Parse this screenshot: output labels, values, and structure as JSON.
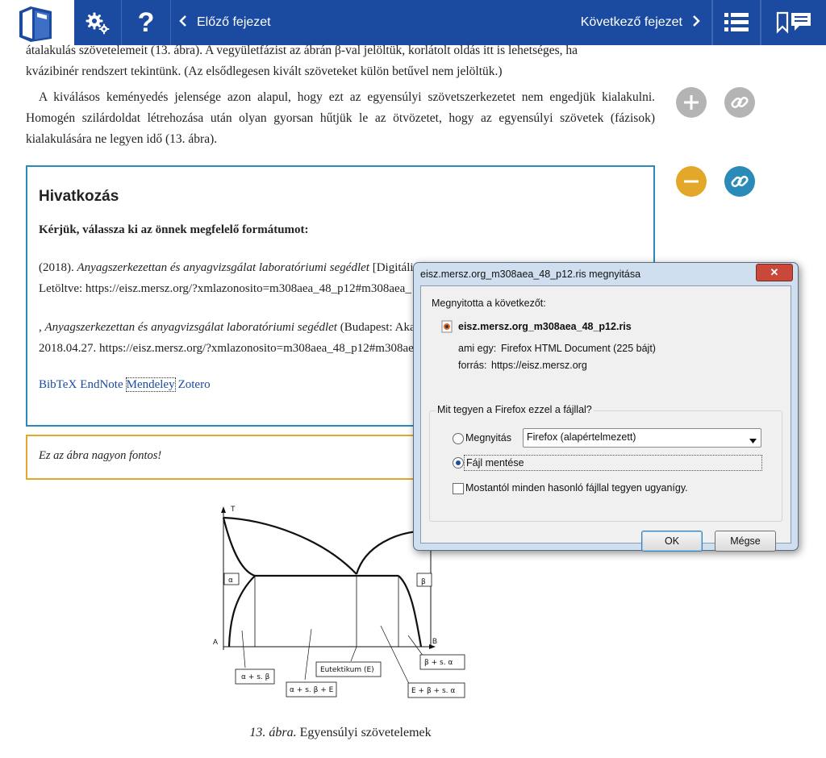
{
  "topbar": {
    "prev_label": "Előző fejezet",
    "next_label": "Következő fejezet",
    "help_glyph": "?"
  },
  "content": {
    "p1_line1": "átalakulás szövetelemeit (13. ábra). A vegyületfázist az ábrán β-val jelöltük, korlátolt oldás itt is lehetséges, ha",
    "p1_line2": "kvázibinér rendszert tekintünk. (Az elsődlegesen kivált szöveteket külön betűvel nem jelöltük.)",
    "p2": "A kiválásos keményedés jelensége azon alapul, hogy ezt az egyensúlyi szövetszerkezetet nem engedjük kialakulni. Homogén szilárdoldat létrehozása után olyan gyorsan hűtjük le az ötvözetet, hogy az egyensúlyi szövetek (fázisok) kialakulására ne legyen idő (13. ábra)."
  },
  "reference": {
    "title": "Hivatkozás",
    "subtitle": "Kérjük, válassza ki az önnek megfelelő formátumot:",
    "cite1_prefix": "(2018). ",
    "cite1_title": "Anyagszerkezettan és anyagvizsgálat laboratóriumi segédlet",
    "cite1_rest": " [Digitáli",
    "cite1_line2": "Letöltve: https://eisz.mersz.org/?xmlazonosito=m308aea_48_p12#m308aea_",
    "cite2_prefix": ", ",
    "cite2_title": "Anyagszerkezettan és anyagvizsgálat laboratóriumi segédlet",
    "cite2_rest": " (Budapest: Aka",
    "cite2_line2": "2018.04.27. https://eisz.mersz.org/?xmlazonosito=m308aea_48_p12#m308aea",
    "formats": [
      "BibTeX",
      "EndNote",
      "Mendeley",
      "Zotero"
    ]
  },
  "note": "Ez az ábra nagyon fontos!",
  "figure": {
    "axis_t": "T",
    "axis_a": "A",
    "axis_b": "B",
    "label_alpha": "α",
    "label_beta": "β",
    "label_a_sb": "α + s. β",
    "label_a_sb_e": "α + s. β + E",
    "label_eut": "Eutektikum (E)",
    "label_b_sa": "β + s. α",
    "label_e_b_sa": "E + β + s. α"
  },
  "caption_num": "13. ábra.",
  "caption_text": " Egyensúlyi szövetelemek",
  "dialog": {
    "title": "eisz.mersz.org_m308aea_48_p12.ris megnyitása",
    "close": "✕",
    "opened_label": "Megnyitotta a következőt:",
    "filename": "eisz.mersz.org_m308aea_48_p12.ris",
    "type_key": "ami egy:",
    "type_value": "Firefox HTML Document (225 bájt)",
    "source_key": "forrás:",
    "source_value": "https://eisz.mersz.org",
    "question": "Mit tegyen a Firefox ezzel a fájllal?",
    "open_with": "Megnyitás",
    "app_select": "Firefox (alapértelmezett)",
    "save_file": "Fájl mentése",
    "remember": "Mostantól minden hasonló fájllal tegyen ugyanígy.",
    "ok": "OK",
    "cancel": "Mégse",
    "selected_option": "save_file",
    "remember_checked": false
  },
  "colors": {
    "topbar": "#1b4aa1",
    "ref_border": "#2a8ab8",
    "note_border": "#e3a72a",
    "minus_circle": "#e3a72a",
    "link_circle": "#2a8ab8",
    "gray_circle": "#b4b4b4"
  }
}
